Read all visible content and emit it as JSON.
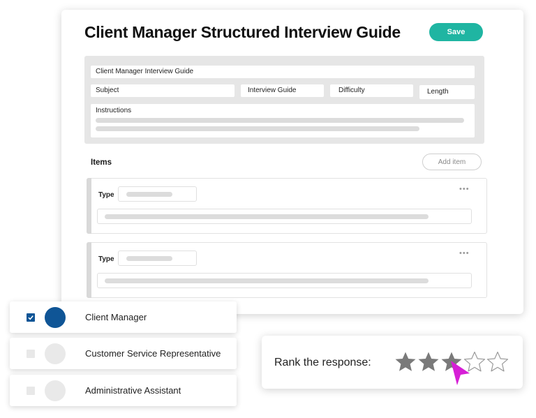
{
  "editor": {
    "title": "Client Manager Structured Interview Guide",
    "save_label": "Save",
    "fields": {
      "name": "Client Manager Interview Guide",
      "subject": "Subject",
      "category": "Interview Guide",
      "difficulty": "Difficulty",
      "length": "Length",
      "instructions": "Instructions"
    },
    "items_heading": "Items",
    "add_item_label": "Add item",
    "items": [
      {
        "type_label": "Type",
        "more_icon": "more-icon"
      },
      {
        "type_label": "Type",
        "more_icon": "more-icon"
      }
    ]
  },
  "roles": [
    {
      "label": "Client Manager",
      "checked": true
    },
    {
      "label": "Customer Service Representative",
      "checked": false
    },
    {
      "label": "Administrative Assistant",
      "checked": false
    }
  ],
  "rating": {
    "prompt": "Rank the response:",
    "value": 3,
    "max": 5
  },
  "colors": {
    "accent": "#1fb5a2",
    "primary": "#0f5596",
    "cursor": "#d61fd6",
    "star_filled": "#7a7a7a"
  }
}
